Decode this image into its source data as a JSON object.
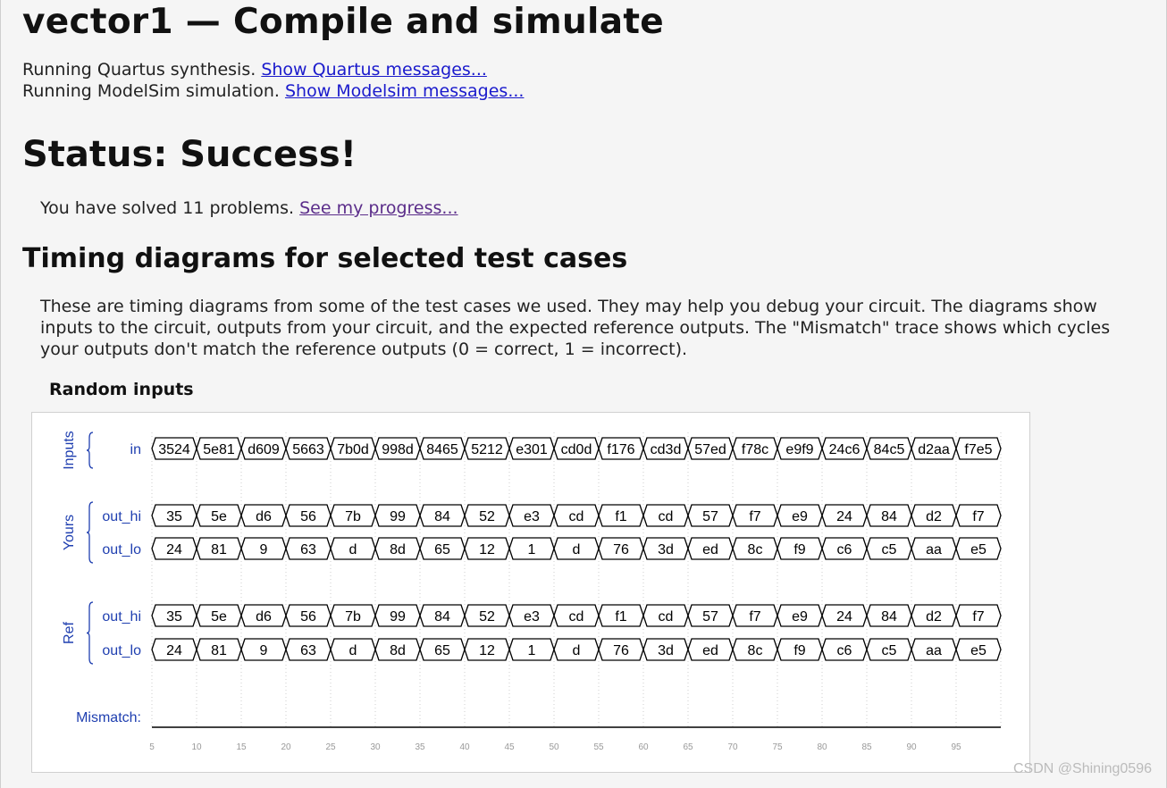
{
  "page": {
    "title": "vector1 — Compile and simulate",
    "quartus_text": "Running Quartus synthesis.",
    "quartus_link": "Show Quartus messages...",
    "modelsim_text": "Running ModelSim simulation.",
    "modelsim_link": "Show Modelsim messages...",
    "status": "Status: Success!",
    "progress_text": "You have solved 11 problems.",
    "progress_link": "See my progress...",
    "timing_heading": "Timing diagrams for selected test cases",
    "description": "These are timing diagrams from some of the test cases we used. They may help you debug your circuit. The diagrams show inputs to the circuit, outputs from your circuit, and the expected reference outputs. The \"Mismatch\" trace shows which cycles your outputs don't match the reference outputs (0 = correct, 1 = incorrect).",
    "testcase_heading": "Random inputs",
    "watermark": "CSDN @Shining0596"
  },
  "waveform": {
    "groups": [
      "Inputs",
      "Yours",
      "Ref"
    ],
    "signal_names": [
      "in",
      "out_hi",
      "out_lo",
      "out_hi",
      "out_lo"
    ],
    "mismatch_label": "Mismatch:",
    "signals": {
      "in": [
        "3524",
        "5e81",
        "d609",
        "5663",
        "7b0d",
        "998d",
        "8465",
        "5212",
        "e301",
        "cd0d",
        "f176",
        "cd3d",
        "57ed",
        "f78c",
        "e9f9",
        "24c6",
        "84c5",
        "d2aa",
        "f7e5"
      ],
      "yours_out_hi": [
        "35",
        "5e",
        "d6",
        "56",
        "7b",
        "99",
        "84",
        "52",
        "e3",
        "cd",
        "f1",
        "cd",
        "57",
        "f7",
        "e9",
        "24",
        "84",
        "d2",
        "f7"
      ],
      "yours_out_lo": [
        "24",
        "81",
        "9",
        "63",
        "d",
        "8d",
        "65",
        "12",
        "1",
        "d",
        "76",
        "3d",
        "ed",
        "8c",
        "f9",
        "c6",
        "c5",
        "aa",
        "e5"
      ],
      "ref_out_hi": [
        "35",
        "5e",
        "d6",
        "56",
        "7b",
        "99",
        "84",
        "52",
        "e3",
        "cd",
        "f1",
        "cd",
        "57",
        "f7",
        "e9",
        "24",
        "84",
        "d2",
        "f7"
      ],
      "ref_out_lo": [
        "24",
        "81",
        "9",
        "63",
        "d",
        "8d",
        "65",
        "12",
        "1",
        "d",
        "76",
        "3d",
        "ed",
        "8c",
        "f9",
        "c6",
        "c5",
        "aa",
        "e5"
      ]
    },
    "mismatch": [
      0,
      0,
      0,
      0,
      0,
      0,
      0,
      0,
      0,
      0,
      0,
      0,
      0,
      0,
      0,
      0,
      0,
      0,
      0
    ],
    "time_ticks": [
      "5",
      "10",
      "15",
      "20",
      "25",
      "30",
      "35",
      "40",
      "45",
      "50",
      "55",
      "60",
      "65",
      "70",
      "75",
      "80",
      "85",
      "90",
      "95"
    ],
    "colors": {
      "label": "#1f3fb0",
      "trace": "#000000",
      "tick": "#999999",
      "grid": "#cccccc"
    }
  }
}
